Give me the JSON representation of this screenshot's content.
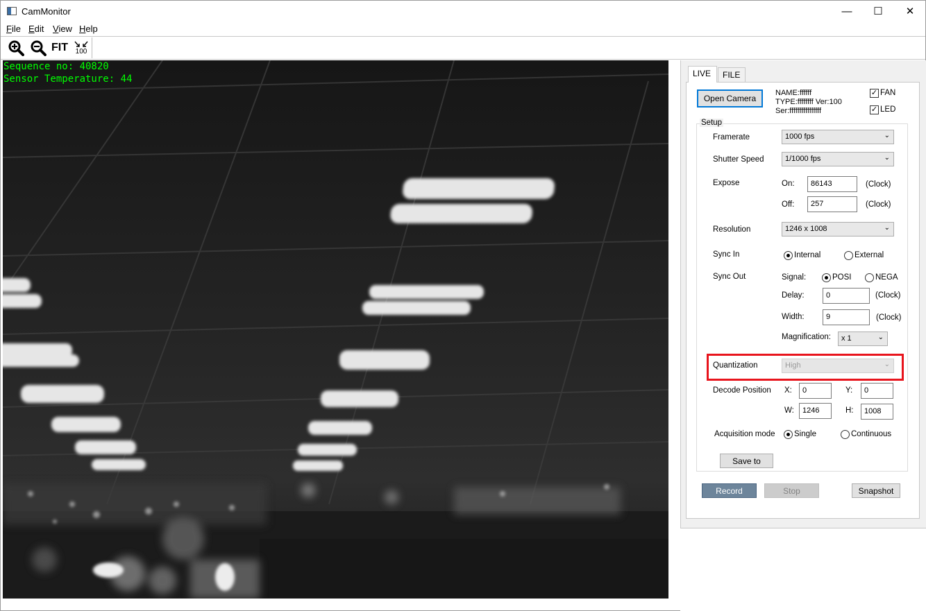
{
  "window": {
    "title": "CamMonitor",
    "minimize": "—",
    "maximize": "☐",
    "close": "✕"
  },
  "menu": {
    "items": [
      {
        "accel": "F",
        "rest": "ile"
      },
      {
        "accel": "E",
        "rest": "dit"
      },
      {
        "accel": "V",
        "rest": "iew"
      },
      {
        "accel": "H",
        "rest": "elp"
      }
    ]
  },
  "toolbar": {
    "zoom_in_icon": "zoom-in-icon",
    "zoom_out_icon": "zoom-out-icon",
    "fit_label": "FIT",
    "actual_size_label": "100"
  },
  "overlay": {
    "sequence": "Sequence no: 40820",
    "temperature": "Sensor Temperature: 44"
  },
  "tabs": [
    "LIVE",
    "FILE"
  ],
  "camera": {
    "open_button": "Open Camera",
    "name": "NAME:ffffff",
    "type": "TYPE:ffffffff Ver:100",
    "serial": "Ser:ffffffffffffffff",
    "fan_label": "FAN",
    "led_label": "LED",
    "fan_checked": "✓",
    "led_checked": "✓"
  },
  "setup": {
    "title": "Setup",
    "framerate_label": "Framerate",
    "framerate_value": "1000 fps",
    "shutter_label": "Shutter Speed",
    "shutter_value": "1/1000 fps",
    "expose_label": "Expose",
    "on_label": "On:",
    "on_value": "86143",
    "off_label": "Off:",
    "off_value": "257",
    "clock_unit": "(Clock)",
    "resolution_label": "Resolution",
    "resolution_value": "1246 x 1008",
    "sync_in_label": "Sync In",
    "sync_internal": "Internal",
    "sync_external": "External",
    "sync_out_label": "Sync Out",
    "signal_label": "Signal:",
    "signal_posi": "POSI",
    "signal_nega": "NEGA",
    "delay_label": "Delay:",
    "delay_value": "0",
    "width_label": "Width:",
    "width_value": "9",
    "magnification_label": "Magnification:",
    "magnification_value": "x 1",
    "quantization_label": "Quantization",
    "quantization_value": "High",
    "decode_label": "Decode Position",
    "x_label": "X:",
    "x_value": "0",
    "y_label": "Y:",
    "y_value": "0",
    "w_label": "W:",
    "w_value": "1246",
    "h_label": "H:",
    "h_value": "1008",
    "acq_label": "Acquisition mode",
    "acq_single": "Single",
    "acq_continuous": "Continuous",
    "save_button": "Save to"
  },
  "actions": {
    "record": "Record",
    "stop": "Stop",
    "snapshot": "Snapshot"
  },
  "colors": {
    "accent": "#0078d7",
    "highlight": "#e8141c",
    "overlay_text": "#00ff00"
  }
}
